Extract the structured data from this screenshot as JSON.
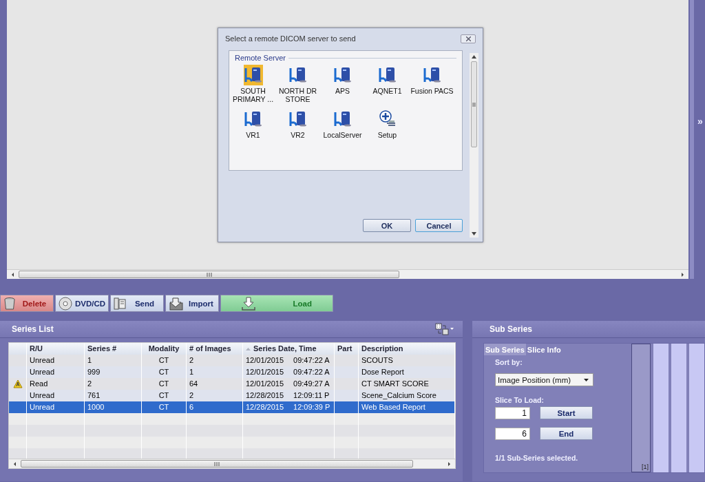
{
  "dialog": {
    "title": "Select a remote DICOM server to send",
    "group_label": "Remote Server",
    "servers": [
      {
        "label": "SOUTH PRIMARY ...",
        "kind": "server",
        "selected": true
      },
      {
        "label": "NORTH DR STORE",
        "kind": "server",
        "selected": false
      },
      {
        "label": "APS",
        "kind": "server",
        "selected": false
      },
      {
        "label": "AQNET1",
        "kind": "server",
        "selected": false
      },
      {
        "label": "Fusion PACS",
        "kind": "server",
        "selected": false
      },
      {
        "label": "VR1",
        "kind": "server",
        "selected": false
      },
      {
        "label": "VR2",
        "kind": "server",
        "selected": false
      },
      {
        "label": "LocalServer",
        "kind": "server",
        "selected": false
      },
      {
        "label": "Setup",
        "kind": "setup",
        "selected": false
      }
    ],
    "buttons": [
      "OK",
      "Cancel"
    ]
  },
  "expand_glyph": "»",
  "toolbar": [
    {
      "label": "Delete",
      "kind": "delete"
    },
    {
      "label": "DVD/CD",
      "kind": "disc"
    },
    {
      "label": "Send",
      "kind": "send"
    },
    {
      "label": "Import",
      "kind": "import"
    },
    {
      "label": "Load",
      "kind": "load"
    }
  ],
  "series_list": {
    "title": "Series List",
    "columns": [
      {
        "label": "R/U",
        "sorted": false
      },
      {
        "label": "Series #",
        "sorted": false
      },
      {
        "label": "Modality",
        "sorted": false
      },
      {
        "label": "# of Images",
        "sorted": false
      },
      {
        "label": "Series Date, Time",
        "sorted": true
      },
      {
        "label": "Part",
        "sorted": false
      },
      {
        "label": "Description",
        "sorted": false
      }
    ],
    "rows": [
      {
        "warning": false,
        "ru": "Unread",
        "series": "1",
        "modality": "CT",
        "images": "2",
        "date": "12/01/2015",
        "time": "09:47:22 A",
        "description": "SCOUTS",
        "selected": false
      },
      {
        "warning": false,
        "ru": "Unread",
        "series": "999",
        "modality": "CT",
        "images": "1",
        "date": "12/01/2015",
        "time": "09:47:22 A",
        "description": "Dose Report",
        "selected": false
      },
      {
        "warning": true,
        "ru": "Read",
        "series": "2",
        "modality": "CT",
        "images": "64",
        "date": "12/01/2015",
        "time": "09:49:27 A",
        "description": "CT SMART SCORE",
        "selected": false
      },
      {
        "warning": false,
        "ru": "Unread",
        "series": "761",
        "modality": "CT",
        "images": "2",
        "date": "12/28/2015",
        "time": "12:09:11 P",
        "description": "Scene_Calcium Score",
        "selected": false
      },
      {
        "warning": false,
        "ru": "Unread",
        "series": "1000",
        "modality": "CT",
        "images": "6",
        "date": "12/28/2015",
        "time": "12:09:39 P",
        "description": "Web Based Report",
        "selected": true
      }
    ]
  },
  "sub_series": {
    "title": "Sub Series",
    "tabs": [
      {
        "label": "Sub Series",
        "selected": true
      },
      {
        "label": "Slice Info",
        "selected": false
      }
    ],
    "sort_label": "Sort by:",
    "sort_value": "Image Position (mm)",
    "slice_label": "Slice To Load:",
    "start_value": "1",
    "start_button": "Start",
    "end_value": "6",
    "end_button": "End",
    "status": "1/1 Sub-Series selected.",
    "thumbnail_label": "[1]"
  }
}
